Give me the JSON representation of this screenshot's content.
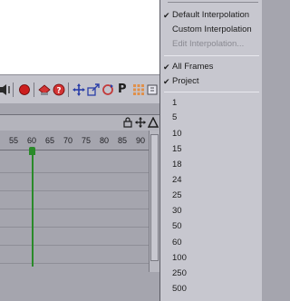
{
  "toolbar": {
    "p_label": "P"
  },
  "ruler": {
    "ticks": [
      "55",
      "60",
      "65",
      "70",
      "75",
      "80",
      "85",
      "90"
    ]
  },
  "menu": {
    "interp": [
      {
        "label": "Default Interpolation",
        "checked": true
      },
      {
        "label": "Custom Interpolation",
        "checked": false
      },
      {
        "label": "Edit Interpolation...",
        "checked": false,
        "disabled": true
      }
    ],
    "scope": [
      {
        "label": "All Frames",
        "checked": true
      },
      {
        "label": "Project",
        "checked": true
      }
    ],
    "counts": [
      "1",
      "5",
      "10",
      "15",
      "18",
      "24",
      "25",
      "30",
      "50",
      "60",
      "100",
      "250",
      "500"
    ]
  },
  "colors": {
    "playhead": "#2a8a2a",
    "record": "#cc1e1e"
  }
}
